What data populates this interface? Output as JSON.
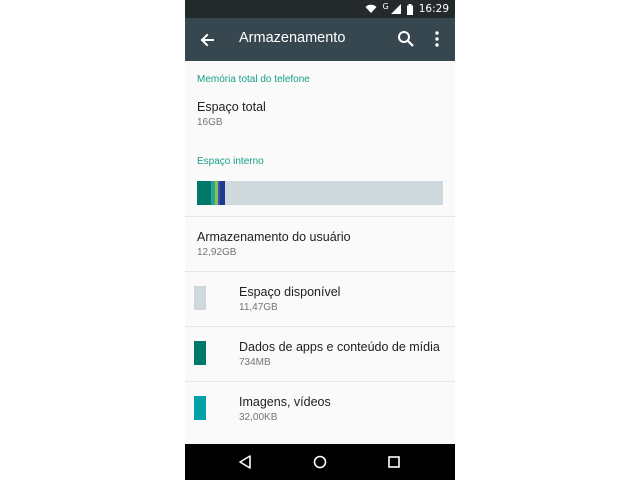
{
  "status_bar": {
    "network_label": "G",
    "time": "16:29"
  },
  "app_bar": {
    "title": "Armazenamento",
    "icons": [
      "back-arrow-icon",
      "search-icon",
      "more-vert-icon"
    ]
  },
  "sections": {
    "total_header": "Memória total do telefone",
    "internal_header": "Espaço interno"
  },
  "total_space": {
    "label": "Espaço total",
    "value": "16GB"
  },
  "usage_bar": {
    "segments": [
      {
        "name": "apps",
        "fraction": 0.055,
        "color": "#00796b"
      },
      {
        "name": "images",
        "fraction": 0.02,
        "color": "#26a69a"
      },
      {
        "name": "audio",
        "fraction": 0.01,
        "color": "#8bc34a"
      },
      {
        "name": "other",
        "fraction": 0.01,
        "color": "#3f51b5"
      },
      {
        "name": "misc",
        "fraction": 0.02,
        "color": "#1e3a8a"
      }
    ],
    "remaining_color": "#cfd8dc"
  },
  "user_storage": {
    "label": "Armazenamento do usuário",
    "value": "12,92GB"
  },
  "items": [
    {
      "label": "Espaço disponível",
      "value": "11,47GB",
      "color": "#cfd8dc"
    },
    {
      "label": "Dados de apps e conteúdo de mídia",
      "value": "734MB",
      "color": "#00796b"
    },
    {
      "label": "Imagens, vídeos",
      "value": "32,00KB",
      "color": "#00a2a8"
    }
  ],
  "nav_bar": {
    "icons": [
      "back-triangle-icon",
      "home-circle-icon",
      "recents-square-icon"
    ]
  }
}
